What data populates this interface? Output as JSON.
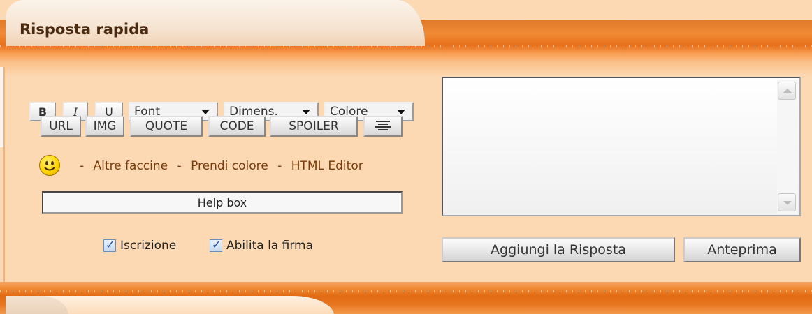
{
  "header": {
    "title": "Risposta rapida"
  },
  "toolbar": {
    "bold_label": "B",
    "italic_label": "I",
    "underline_label": "U",
    "font_select": "Font",
    "size_select": "Dimens.",
    "color_select": "Colore",
    "buttons": [
      "URL",
      "IMG",
      "QUOTE",
      "CODE",
      "SPOILER"
    ],
    "align_icon": "align-center-icon"
  },
  "links": {
    "separator": "-",
    "more_smileys": "Altre faccine",
    "pick_color": "Prendi colore",
    "html_editor": "HTML Editor",
    "smiley_icon": "smiley-icon"
  },
  "help_box": {
    "value": "Help box"
  },
  "options": {
    "subscribe_label": "Iscrizione",
    "subscribe_checked": true,
    "signature_label": "Abilita la firma",
    "signature_checked": true
  },
  "message": {
    "value": ""
  },
  "actions": {
    "submit_label": "Aggiungi la Risposta",
    "preview_label": "Anteprima"
  },
  "colors": {
    "band_orange": "#e86f1a",
    "background": "#fcd9b3",
    "link_color": "#7a3a0a"
  }
}
